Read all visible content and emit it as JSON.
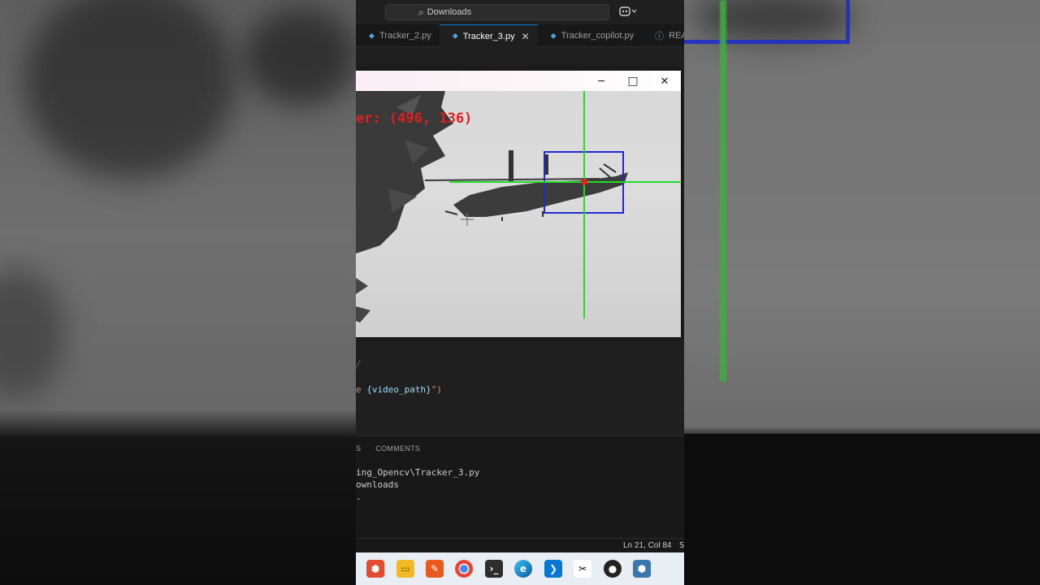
{
  "titlebar": {
    "search_text": "Downloads",
    "search_icon": "search-icon",
    "copilot_icon": "copilot-icon"
  },
  "tabs": [
    {
      "label": "Tracker_2.py",
      "active": false
    },
    {
      "label": "Tracker_3.py",
      "active": true
    },
    {
      "label": "Tracker_copilot.py",
      "active": false
    },
    {
      "label": "REA",
      "active": false
    }
  ],
  "editor": {
    "line_a": "/",
    "line_b_prefix": "e ",
    "line_b_var": "{video_path}",
    "line_b_suffix": "\")"
  },
  "cv_window": {
    "center_text": "er: (496, 136)",
    "minimize": "─",
    "maximize": "□",
    "close": "✕"
  },
  "panel": {
    "tab_left": "S",
    "tab_comments": "COMMENTS",
    "term_line1": "ing_Opencv\\Tracker_3.py",
    "term_line2": "ownloads",
    "term_line3": "."
  },
  "statusbar": {
    "position": "Ln 21, Col 84",
    "extra": "S"
  },
  "taskbar": {
    "icons": [
      "sap-icon",
      "file-explorer-icon",
      "reader-icon",
      "chrome-icon",
      "terminal-icon",
      "edge-icon",
      "vscode-icon",
      "capcut-icon",
      "github-desktop-icon",
      "python-icon"
    ]
  },
  "colors": {
    "accent": "#0078d4",
    "tracker_box": "#1b2bd0",
    "crosshair": "#22dd22",
    "center_dot": "#e02020"
  }
}
